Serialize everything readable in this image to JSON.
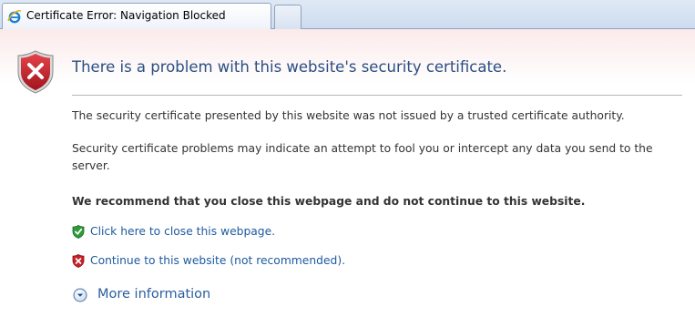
{
  "browser": {
    "tab_title": "Certificate Error: Navigation Blocked",
    "tab_icon": "internet-explorer-icon",
    "new_tab_icon": "new-tab-icon"
  },
  "page": {
    "heading": "There is a problem with this website's security certificate.",
    "paragraph_1": "The security certificate presented by this website was not issued by a trusted certificate authority.",
    "paragraph_2": "Security certificate problems may indicate an attempt to fool you or intercept any data you send to the server.",
    "recommendation": "We recommend that you close this webpage and do not continue to this website.",
    "close_link": "Click here to close this webpage.",
    "continue_link": "Continue to this website (not recommended).",
    "more_info": "More information",
    "icons": {
      "main": "red-shield-error-icon",
      "close": "green-shield-check-icon",
      "continue": "red-shield-x-icon",
      "more": "expand-down-circle-icon"
    }
  },
  "colors": {
    "heading": "#2a4f84",
    "link": "#1e5aa0",
    "error_red": "#c8202a",
    "safe_green": "#2f9a3a"
  }
}
